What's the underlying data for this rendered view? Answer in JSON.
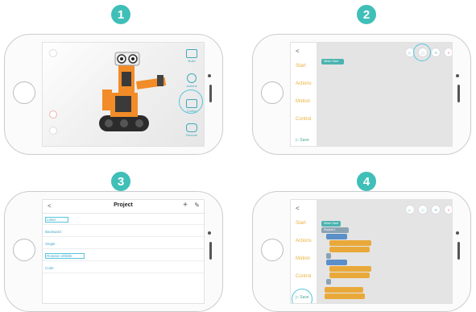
{
  "steps": [
    "1",
    "2",
    "3",
    "4"
  ],
  "accent": "#3fbfb8",
  "screen1": {
    "menu": [
      "Build",
      "Actions",
      "Coding",
      "Remote"
    ],
    "icons": [
      "build-icon",
      "actions-icon",
      "coding-icon",
      "remote-icon"
    ]
  },
  "screen2": {
    "back": "<",
    "categories": [
      "Start",
      "Actions",
      "Motion",
      "Control"
    ],
    "save": "▷ Save",
    "start_block": "When Start",
    "toolbar": [
      "▷",
      "◻",
      "⟲",
      "⏸"
    ]
  },
  "screen3": {
    "back": "<",
    "title": "Project",
    "add": "+",
    "edit": "✎",
    "rows": [
      "Letter",
      "Backward",
      "Single",
      "Rotation dribble",
      "Code"
    ]
  },
  "screen4": {
    "back": "<",
    "categories": [
      "Start",
      "Actions",
      "Motion",
      "Control"
    ],
    "save": "▷ Save",
    "start_block": "When Start",
    "repeat": "Repeat  1",
    "toolbar": [
      "▷",
      "◻",
      "⟲",
      "⏸"
    ]
  }
}
